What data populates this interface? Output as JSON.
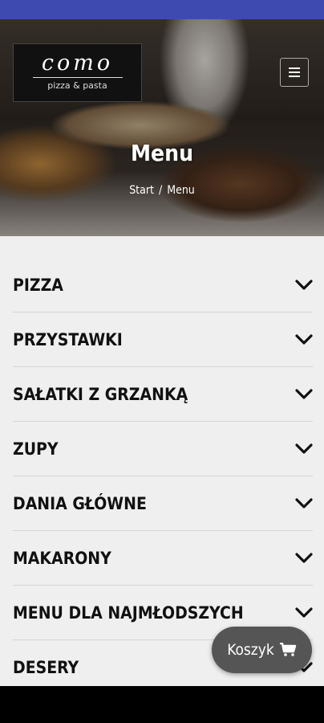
{
  "logo": {
    "word": "como",
    "subtitle": "pizza & pasta"
  },
  "hero": {
    "title": "Menu"
  },
  "breadcrumb": {
    "start": "Start",
    "separator": "/",
    "current": "Menu"
  },
  "menu": {
    "categories": [
      {
        "label": "PIZZA"
      },
      {
        "label": "PRZYSTAWKI"
      },
      {
        "label": "SAŁATKI Z GRZANKĄ"
      },
      {
        "label": "ZUPY"
      },
      {
        "label": "DANIA GŁÓWNE"
      },
      {
        "label": "MAKARONY"
      },
      {
        "label": "MENU DLA NAJMŁODSZYCH"
      },
      {
        "label": "DESERY"
      }
    ]
  },
  "cart": {
    "label": "Koszyk",
    "icon": "cart-icon"
  },
  "colors": {
    "status_bar": "#3f4ab0",
    "cart_button": "#555555",
    "menu_background": "#efefef"
  }
}
